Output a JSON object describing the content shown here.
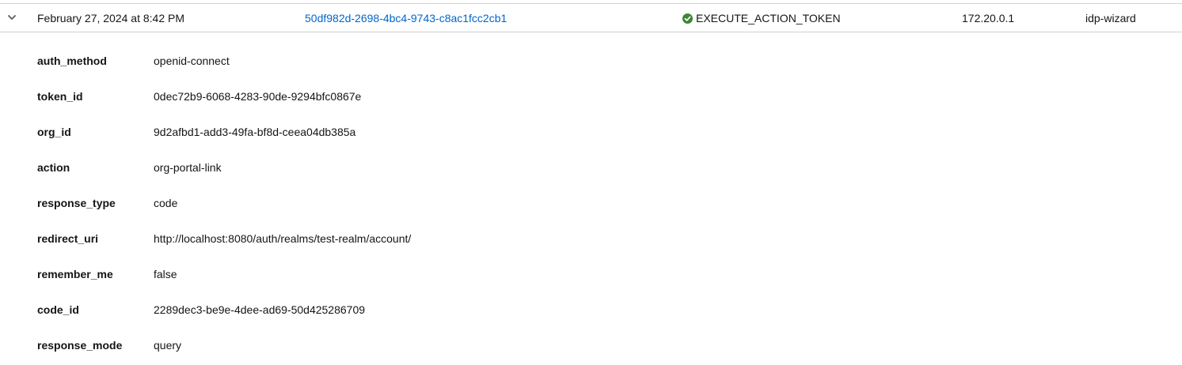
{
  "event_row": {
    "time": "February 27, 2024 at 8:42 PM",
    "user_id": "50df982d-2698-4bc4-9743-c8ac1fcc2cb1",
    "event_type": "EXECUTE_ACTION_TOKEN",
    "ip_address": "172.20.0.1",
    "client": "idp-wizard",
    "status_color": "#3e8635",
    "link_color": "#0066cc"
  },
  "details": [
    {
      "key": "auth_method",
      "value": "openid-connect"
    },
    {
      "key": "token_id",
      "value": "0dec72b9-6068-4283-90de-9294bfc0867e"
    },
    {
      "key": "org_id",
      "value": "9d2afbd1-add3-49fa-bf8d-ceea04db385a"
    },
    {
      "key": "action",
      "value": "org-portal-link"
    },
    {
      "key": "response_type",
      "value": "code"
    },
    {
      "key": "redirect_uri",
      "value": "http://localhost:8080/auth/realms/test-realm/account/"
    },
    {
      "key": "remember_me",
      "value": "false"
    },
    {
      "key": "code_id",
      "value": "2289dec3-be9e-4dee-ad69-50d425286709"
    },
    {
      "key": "response_mode",
      "value": "query"
    }
  ]
}
